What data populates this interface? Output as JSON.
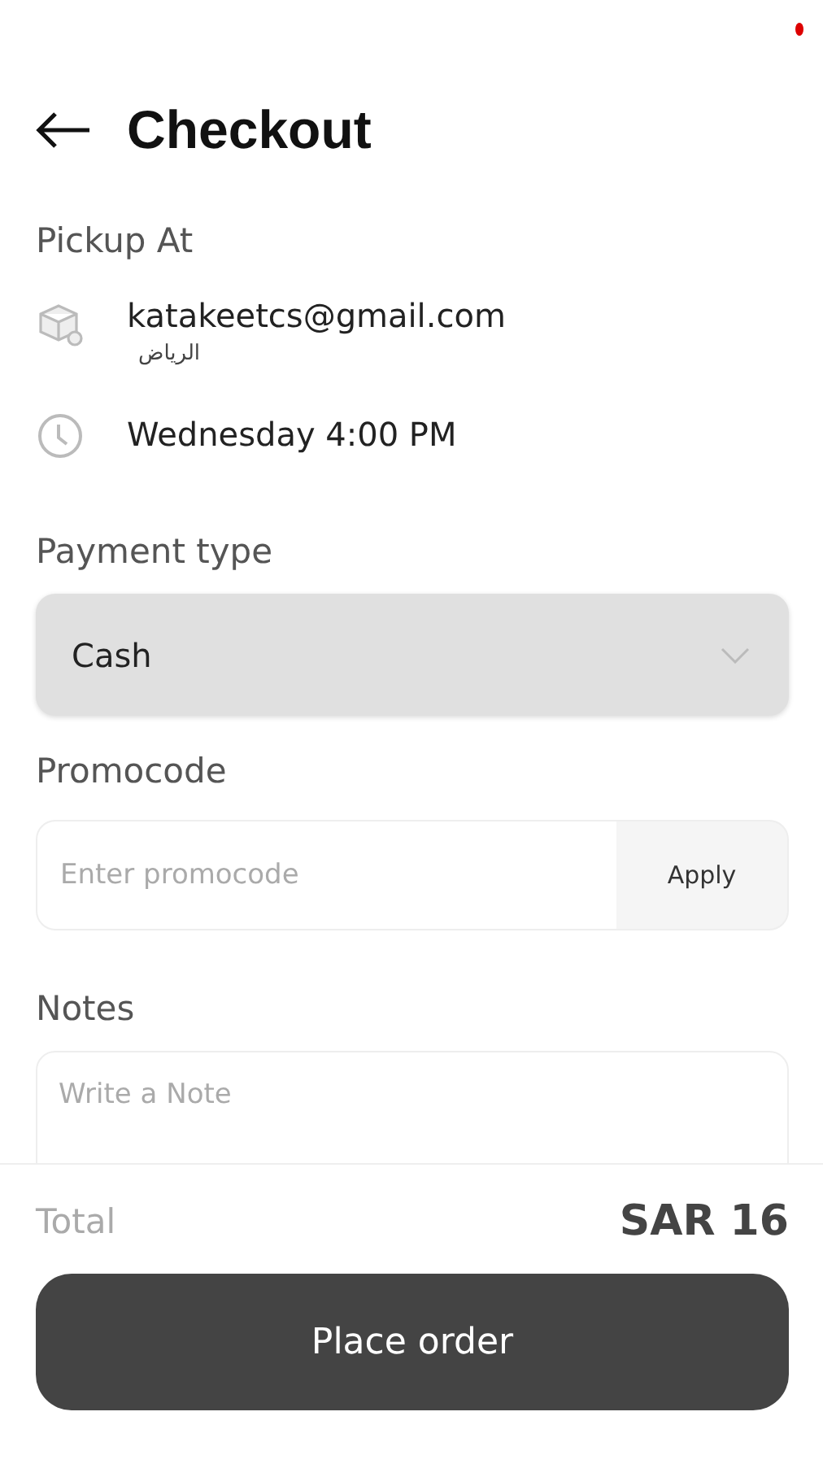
{
  "header": {
    "title": "Checkout"
  },
  "pickup": {
    "heading": "Pickup At",
    "store": "katakeetcs@gmail.com",
    "city": "الرياض",
    "time": "Wednesday 4:00 PM"
  },
  "payment": {
    "heading": "Payment type",
    "value": "Cash"
  },
  "promo": {
    "heading": "Promocode",
    "placeholder": "Enter promocode",
    "button": "Apply"
  },
  "notes": {
    "heading": "Notes",
    "placeholder": "Write a Note"
  },
  "footer": {
    "total_label": "Total",
    "total_value": "SAR 16",
    "button": "Place order"
  }
}
